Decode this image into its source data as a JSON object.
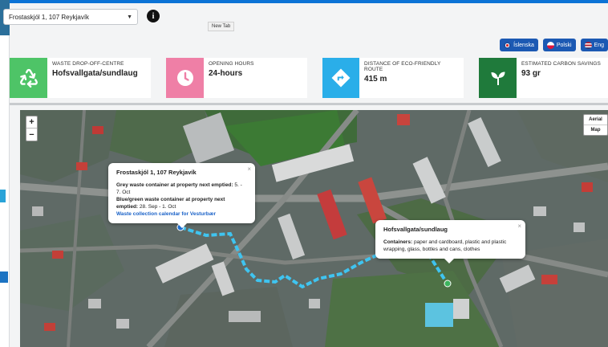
{
  "address": {
    "selected": "Frostaskjól 1, 107 Reykjavík"
  },
  "tooltip": {
    "new_tab": "New Tab"
  },
  "languages": [
    {
      "label": "Íslenska",
      "flag": "iceland-flag-icon"
    },
    {
      "label": "Polski",
      "flag": "poland-flag-icon"
    },
    {
      "label": "Eng",
      "flag": "uk-flag-icon"
    }
  ],
  "cards": [
    {
      "label": "WASTE DROP-OFF-CENTRE",
      "value": "Hofsvallgata/sundlaug",
      "icon": "recycle-icon",
      "color": "#4ec467"
    },
    {
      "label": "OPENING HOURS",
      "value": "24-hours",
      "icon": "clock-icon",
      "color": "#ef7fa6"
    },
    {
      "label": "DISTANCE OF ECO-FRIENDLY ROUTE",
      "value": "415 m",
      "icon": "route-arrow-icon",
      "color": "#2aaee9"
    },
    {
      "label": "ESTIMATED CARBON SAVINGS",
      "value": "93 gr",
      "icon": "sprout-icon",
      "color": "#1f7a3b"
    }
  ],
  "map": {
    "zoom_in": "+",
    "zoom_out": "−",
    "type_aerial": "Aerial",
    "type_map": "Map",
    "route_color": "#3fc4f0",
    "home_popup": {
      "title": "Frostaskjól 1, 107 Reykjavík",
      "grey_label": "Grey waste container at property next emptied:",
      "grey_value": "5. - 7. Oct",
      "blue_label": "Blue/green waste container at property next emptied:",
      "blue_value": "28. Sep - 1. Oct",
      "link": "Waste collection calendar for Vesturbær"
    },
    "dest_popup": {
      "title": "Hofsvallgata/sundlaug",
      "containers_label": "Containers:",
      "containers_value": "paper and cardboard, plastic and plastic wrapping, glass, bottles and cans, clothes"
    },
    "close": "×"
  }
}
